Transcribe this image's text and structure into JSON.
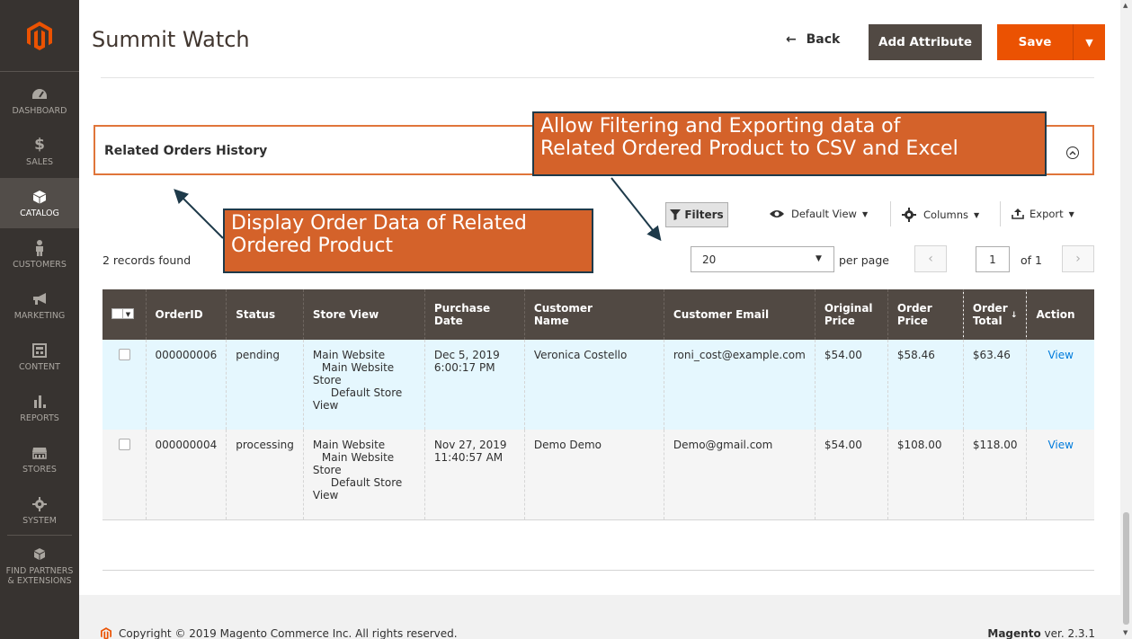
{
  "sidebar": {
    "items": [
      {
        "label": "DASHBOARD",
        "icon": "dashboard-icon"
      },
      {
        "label": "SALES",
        "icon": "dollar-icon"
      },
      {
        "label": "CATALOG",
        "icon": "box-icon"
      },
      {
        "label": "CUSTOMERS",
        "icon": "person-icon"
      },
      {
        "label": "MARKETING",
        "icon": "megaphone-icon"
      },
      {
        "label": "CONTENT",
        "icon": "layout-icon"
      },
      {
        "label": "REPORTS",
        "icon": "bar-chart-icon"
      },
      {
        "label": "STORES",
        "icon": "storefront-icon"
      },
      {
        "label": "SYSTEM",
        "icon": "gear-icon"
      },
      {
        "label": "FIND PARTNERS & EXTENSIONS",
        "icon": "cubes-icon"
      }
    ]
  },
  "header": {
    "title": "Summit Watch",
    "back_label": "Back",
    "add_attribute_label": "Add Attribute",
    "save_label": "Save"
  },
  "section": {
    "title": "Related Orders History"
  },
  "callouts": {
    "right": [
      "Allow Filtering and Exporting data of",
      "Related Ordered Product to CSV and Excel"
    ],
    "left": [
      "Display Order Data of Related",
      "Ordered Product"
    ]
  },
  "toolbar": {
    "filters_label": "Filters",
    "view_label": "Default View",
    "columns_label": "Columns",
    "export_label": "Export",
    "records_found": "2 records found",
    "per_page_value": "20",
    "per_page_label": "per page",
    "page_value": "1",
    "page_of": "of 1"
  },
  "table": {
    "columns": [
      "OrderID",
      "Status",
      "Store View",
      "Purchase Date",
      "Customer Name",
      "Customer Email",
      "Original Price",
      "Order Price",
      "Order Total",
      "Action"
    ],
    "header_lines": [
      [
        "OrderID"
      ],
      [
        "Status"
      ],
      [
        "Store View"
      ],
      [
        "Purchase Date"
      ],
      [
        "Customer",
        "Name"
      ],
      [
        "Customer Email"
      ],
      [
        "Original",
        "Price"
      ],
      [
        "Order",
        "Price"
      ],
      [
        "Order",
        "Total"
      ],
      [
        "Action"
      ]
    ],
    "rows": [
      {
        "order_id": "000000006",
        "status": "pending",
        "store_view": [
          "Main Website",
          "Main Website",
          "Store",
          "Default Store",
          "View"
        ],
        "purchase_date": "Dec 5, 2019 6:00:17 PM",
        "customer_name": "Veronica Costello",
        "customer_email": "roni_cost@example.com",
        "original_price": "$54.00",
        "order_price": "$58.46",
        "order_total": "$63.46",
        "action": "View"
      },
      {
        "order_id": "000000004",
        "status": "processing",
        "store_view": [
          "Main Website",
          "Main Website",
          "Store",
          "Default Store",
          "View"
        ],
        "purchase_date": "Nov 27, 2019 11:40:57 AM",
        "customer_name": "Demo Demo",
        "customer_email": "Demo@gmail.com",
        "original_price": "$54.00",
        "order_price": "$108.00",
        "order_total": "$118.00",
        "action": "View"
      }
    ]
  },
  "footer": {
    "copyright": "Copyright © 2019 Magento Commerce Inc. All rights reserved.",
    "brand": "Magento",
    "version": "ver. 2.3.1"
  },
  "colors": {
    "sidebar_bg": "#373330",
    "accent_orange": "#eb5202",
    "callout_bg": "#d4622a",
    "table_header_bg": "#514943",
    "row_highlight": "#e5f7fe",
    "link": "#007bdb"
  }
}
